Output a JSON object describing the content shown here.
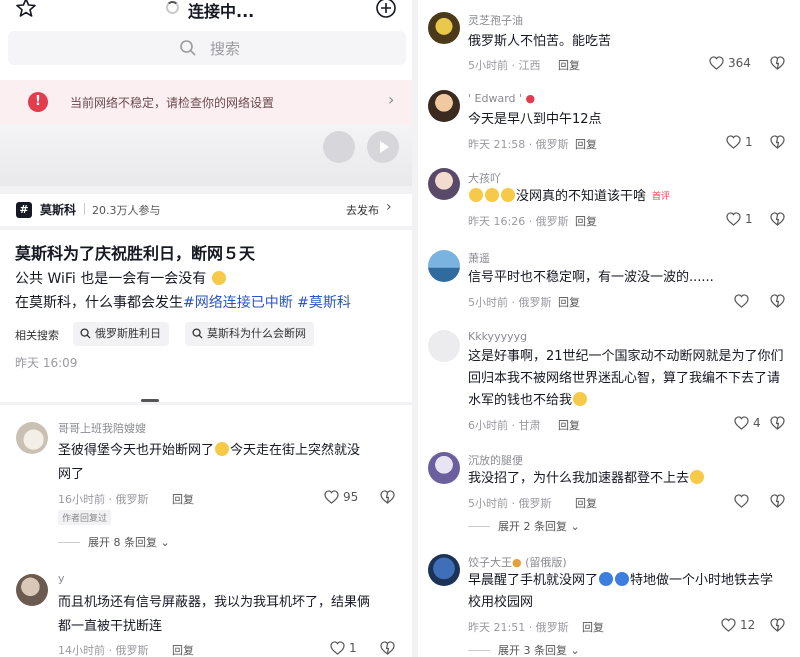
{
  "left": {
    "topbar": {
      "status": "连接中..."
    },
    "search": {
      "placeholder": "搜索"
    },
    "warning": {
      "text": "当前网络不稳定，请检查你的网络设置"
    },
    "topic": {
      "logo": "#",
      "name": "莫斯科",
      "participants": "20.3万人参与",
      "post_label": "去发布"
    },
    "post": {
      "title": "莫斯科为了庆祝胜利日，断网５天",
      "line1": "公共 WiFi 也是一会有一会没有",
      "line2_text": "在莫斯科，什么事都会发生",
      "line2_tags": "#网络连接已中断 #莫斯科",
      "related_label": "相关搜索",
      "related": [
        "俄罗斯胜利日",
        "莫斯科为什么会断网"
      ],
      "time": "昨天 16:09"
    },
    "comments": [
      {
        "user": "哥哥上班我陪嫂嫂",
        "line1": "圣彼得堡今天也开始断网了",
        "line1b": "今天走在街上突然就没",
        "line2": "网了",
        "time": "16小时前 · 俄罗斯",
        "reply": "回复",
        "likes": "95",
        "author_tag": "作者回复过",
        "expand": "展开 8 条回复"
      },
      {
        "user": "y",
        "line1": "而且机场还有信号屏蔽器，我以为我耳机坏了，结果俩",
        "line2": "都一直被干扰断连",
        "time": "14小时前 · 俄罗斯",
        "reply": "回复",
        "likes": "1"
      }
    ]
  },
  "right": {
    "comments": [
      {
        "user": "灵芝孢子油",
        "text": "俄罗斯人不怕苦。能吃苦",
        "time": "5小时前 · 江西",
        "reply": "回复",
        "likes": "364"
      },
      {
        "user": "' Edward '",
        "text": "今天是早八到中午12点",
        "time": "昨天 21:58 · 俄罗斯",
        "reply": "回复",
        "likes": "1"
      },
      {
        "user": "大孩吖",
        "text": "没网真的不知道该干啥",
        "hot": "首评",
        "time": "昨天 16:26 · 俄罗斯",
        "reply": "回复",
        "likes": "1"
      },
      {
        "user": "萧遥",
        "text": "信号平时也不稳定啊，有一波没一波的......",
        "time": "5小时前 · 俄罗斯",
        "reply": "回复",
        "likes": ""
      },
      {
        "user": "Kkkyyyyyg",
        "line1": "这是好事啊，21世纪一个国家动不动断网就是为了你们",
        "line2": "回归本我不被网络世界迷乱心智，算了我编不下去了请",
        "line3": "水军的钱也不给我",
        "time": "6小时前 · 甘肃",
        "reply": "回复",
        "likes": "4"
      },
      {
        "user": "沉放的腿便",
        "text": "我没招了，为什么我加速器都登不上去",
        "time": "5小时前 · 俄罗斯",
        "reply": "回复",
        "likes": "",
        "expand": "展开 2 条回复"
      },
      {
        "user": "饺子大王",
        "user_suffix": "(留俄版)",
        "line1": "早晨醒了手机就没网了",
        "line1b": "特地做一个小时地铁去学",
        "line2": "校用校园网",
        "time": "昨天 21:51 · 俄罗斯",
        "reply": "回复",
        "likes": "12",
        "expand": "展开 3 条回复"
      }
    ]
  },
  "colors": {
    "accent_red": "#e33c4c",
    "tag_blue": "#2b55c7",
    "warning_bg": "#fbeff1"
  }
}
